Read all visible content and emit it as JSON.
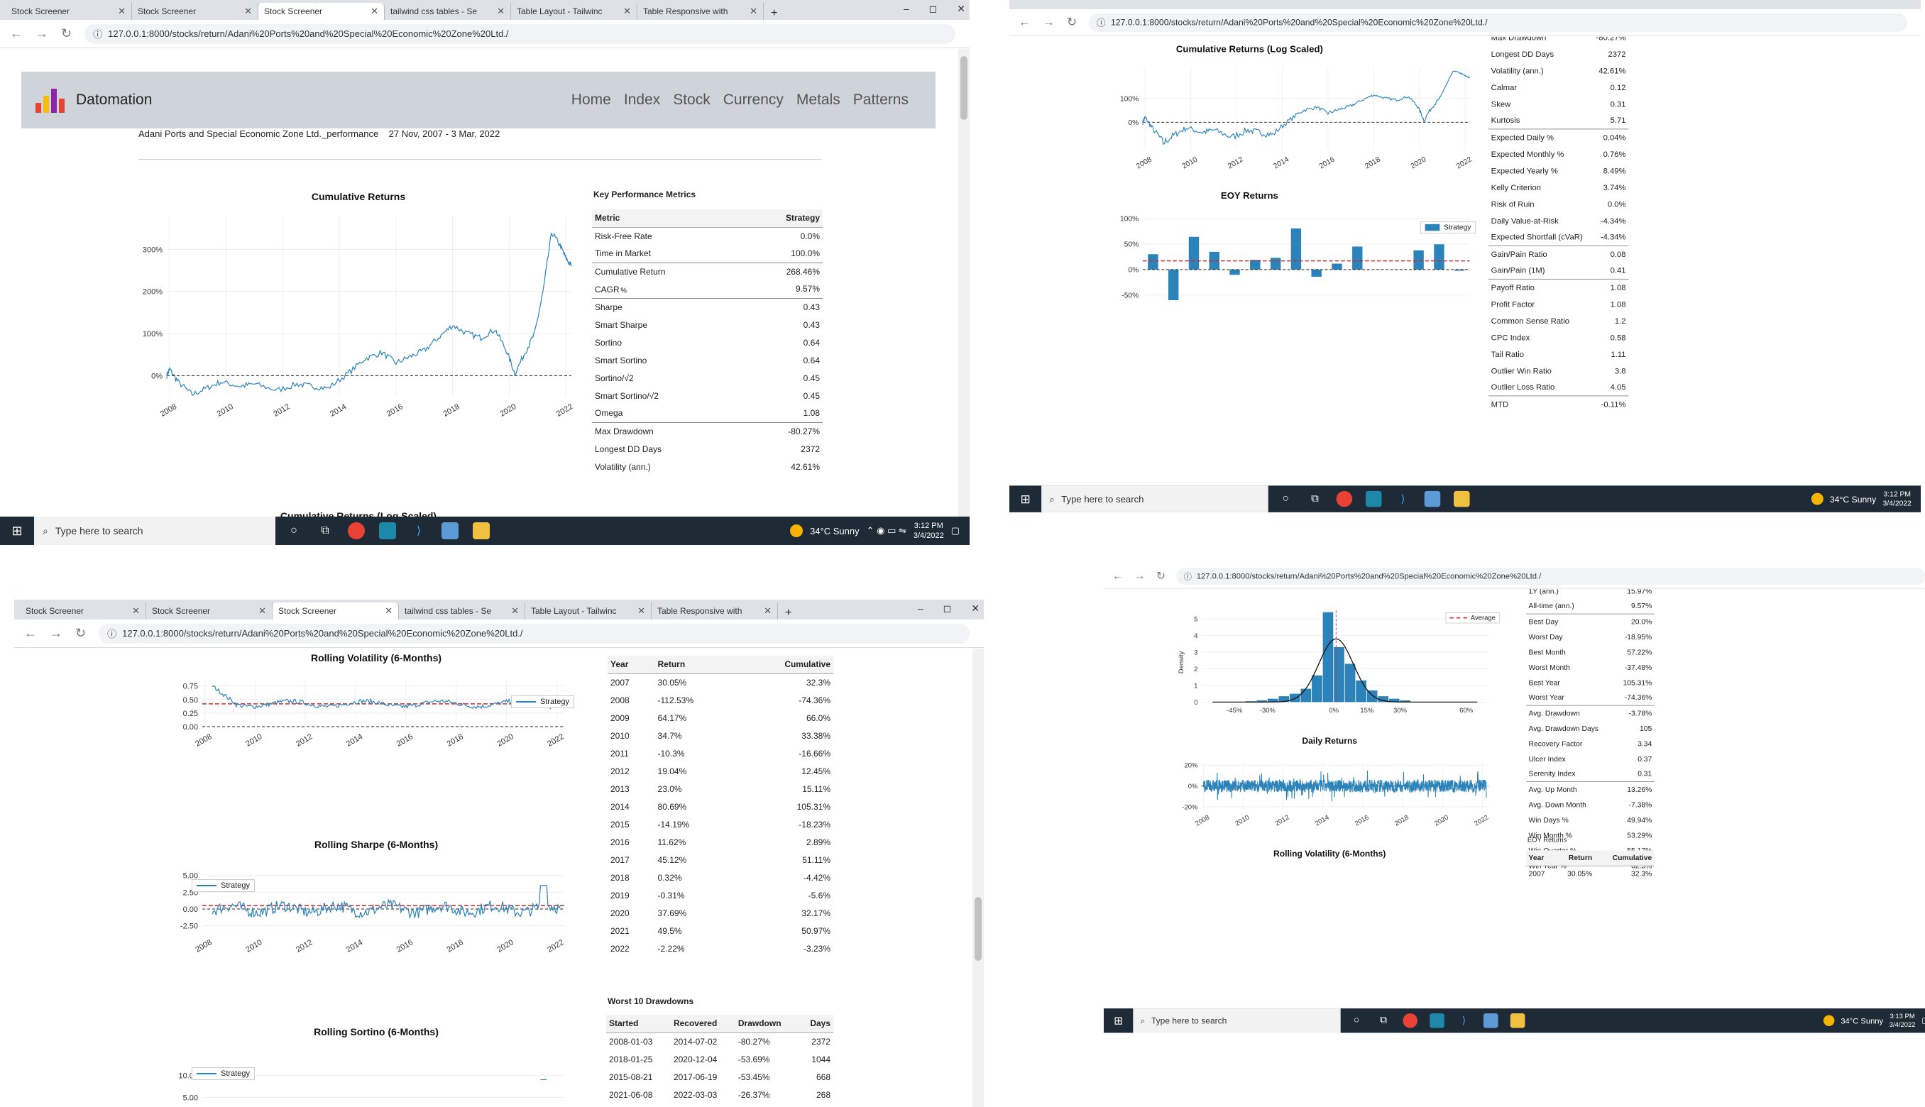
{
  "browser": {
    "tabs": [
      "Stock Screener",
      "Stock Screener",
      "Stock Screener",
      "tailwind css tables - Se",
      "Table Layout - Tailwinc",
      "Table Responsive with"
    ],
    "url": "127.0.0.1:8000/stocks/return/Adani%20Ports%20and%20Special%20Economic%20Zone%20Ltd./",
    "url_q4": "127.0.0.1:8000/stocks/return/Adani%20Ports%20and%20Special%20Economic%20Zone%20Ltd./",
    "new_tab": "+",
    "minimize": "–",
    "maximize": "◻",
    "close": "✕"
  },
  "navbar": {
    "brand": "Datomation",
    "links": [
      "Home",
      "Index",
      "Stock",
      "Currency",
      "Metals",
      "Patterns"
    ]
  },
  "report": {
    "subtitle": "Adani Ports and Special Economic Zone Ltd._performance",
    "date_range": "27 Nov, 2007 - 3 Mar, 2022"
  },
  "charts": {
    "cumulative_title": "Cumulative Returns",
    "cumulative_log_title": "Cumulative Returns (Log Scaled)",
    "eoy_title": "EOY Returns",
    "daily_title": "Daily Returns",
    "rolling_vol_title": "Rolling Volatility (6-Months)",
    "rolling_sharpe_title": "Rolling Sharpe (6-Months)",
    "rolling_sortino_title": "Rolling Sortino (6-Months)",
    "years": [
      "2008",
      "2010",
      "2012",
      "2014",
      "2016",
      "2018",
      "2020",
      "2022"
    ],
    "cum_yticks": [
      "300%",
      "200%",
      "100%",
      "0%"
    ],
    "log_yticks": [
      "100%",
      "0%"
    ],
    "eoy_yticks": [
      "100%",
      "50%",
      "0%",
      "-50%"
    ],
    "daily_yticks": [
      "20%",
      "0%",
      "-20%"
    ],
    "vol_yticks": [
      "0.75",
      "0.50",
      "0.25",
      "0.00"
    ],
    "sharpe_yticks": [
      "5.00",
      "2.50",
      "0.00",
      "-2.50"
    ],
    "sortino_yticks": [
      "10.00",
      "5.00"
    ],
    "hist_yticks": [
      "5",
      "4",
      "3",
      "2",
      "1",
      "0"
    ],
    "hist_xticks": [
      "-45%",
      "-30%",
      "0%",
      "15%",
      "30%",
      "60%"
    ],
    "hist_ylabel": "Density",
    "legend_strategy": "Strategy",
    "legend_average": "Average"
  },
  "chart_data": [
    {
      "type": "line",
      "title": "Cumulative Returns",
      "x_range": [
        2007.9,
        2022.2
      ],
      "ylim": [
        -50,
        380
      ],
      "series": [
        {
          "name": "Strategy",
          "points": [
            [
              2007.9,
              0
            ],
            [
              2008.0,
              15
            ],
            [
              2008.3,
              -15
            ],
            [
              2008.8,
              -45
            ],
            [
              2009.3,
              -30
            ],
            [
              2009.8,
              -15
            ],
            [
              2010.5,
              -25
            ],
            [
              2011.0,
              -20
            ],
            [
              2011.8,
              -35
            ],
            [
              2012.5,
              -20
            ],
            [
              2013.0,
              -25
            ],
            [
              2013.6,
              -30
            ],
            [
              2014.3,
              5
            ],
            [
              2014.9,
              40
            ],
            [
              2015.5,
              55
            ],
            [
              2016.0,
              30
            ],
            [
              2016.5,
              45
            ],
            [
              2017.0,
              60
            ],
            [
              2017.5,
              90
            ],
            [
              2018.0,
              120
            ],
            [
              2018.5,
              100
            ],
            [
              2019.0,
              90
            ],
            [
              2019.5,
              110
            ],
            [
              2019.9,
              60
            ],
            [
              2020.2,
              5
            ],
            [
              2020.6,
              60
            ],
            [
              2020.9,
              100
            ],
            [
              2021.2,
              200
            ],
            [
              2021.5,
              340
            ],
            [
              2021.8,
              310
            ],
            [
              2022.0,
              280
            ],
            [
              2022.2,
              260
            ]
          ]
        }
      ]
    },
    {
      "type": "bar",
      "title": "EOY Returns",
      "categories": [
        "2007",
        "2008",
        "2009",
        "2010",
        "2011",
        "2012",
        "2013",
        "2014",
        "2015",
        "2016",
        "2017",
        "2018",
        "2019",
        "2020",
        "2021",
        "2022"
      ],
      "values": [
        30.05,
        -112.53,
        64.17,
        34.7,
        -10.3,
        19.04,
        23.0,
        80.69,
        -14.19,
        11.62,
        45.12,
        0.32,
        -0.31,
        37.69,
        49.5,
        -2.22
      ],
      "ylim": [
        -60,
        110
      ],
      "series": [
        {
          "name": "Strategy"
        }
      ]
    }
  ],
  "metrics": {
    "title": "Key Performance Metrics",
    "header": [
      "Metric",
      "Strategy"
    ],
    "rows": [
      [
        "Risk-Free Rate",
        "0.0%"
      ],
      [
        "Time in Market",
        "100.0%"
      ],
      [
        "Cumulative Return",
        "268.46%"
      ],
      [
        "CAGR﹪",
        "9.57%"
      ],
      [
        "Sharpe",
        "0.43"
      ],
      [
        "Smart Sharpe",
        "0.43"
      ],
      [
        "Sortino",
        "0.64"
      ],
      [
        "Smart Sortino",
        "0.64"
      ],
      [
        "Sortino/√2",
        "0.45"
      ],
      [
        "Smart Sortino/√2",
        "0.45"
      ],
      [
        "Omega",
        "1.08"
      ],
      [
        "Max Drawdown",
        "-80.27%"
      ],
      [
        "Longest DD Days",
        "2372"
      ],
      [
        "Volatility (ann.)",
        "42.61%"
      ]
    ],
    "q2_rows": [
      [
        "Max Drawdown",
        "-80.27%"
      ],
      [
        "Longest DD Days",
        "2372"
      ],
      [
        "Volatility (ann.)",
        "42.61%"
      ],
      [
        "Calmar",
        "0.12"
      ],
      [
        "Skew",
        "0.31"
      ],
      [
        "Kurtosis",
        "5.71"
      ],
      [
        "Expected Daily %",
        "0.04%"
      ],
      [
        "Expected Monthly %",
        "0.76%"
      ],
      [
        "Expected Yearly %",
        "8.49%"
      ],
      [
        "Kelly Criterion",
        "3.74%"
      ],
      [
        "Risk of Ruin",
        "0.0%"
      ],
      [
        "Daily Value-at-Risk",
        "-4.34%"
      ],
      [
        "Expected Shortfall (cVaR)",
        "-4.34%"
      ],
      [
        "Gain/Pain Ratio",
        "0.08"
      ],
      [
        "Gain/Pain (1M)",
        "0.41"
      ],
      [
        "Payoff Ratio",
        "1.08"
      ],
      [
        "Profit Factor",
        "1.08"
      ],
      [
        "Common Sense Ratio",
        "1.2"
      ],
      [
        "CPC Index",
        "0.58"
      ],
      [
        "Tail Ratio",
        "1.11"
      ],
      [
        "Outlier Win Ratio",
        "3.8"
      ],
      [
        "Outlier Loss Ratio",
        "4.05"
      ],
      [
        "MTD",
        "-0.11%"
      ]
    ],
    "q4_rows": [
      [
        "1Y (ann.)",
        "15.97%"
      ],
      [
        "All-time (ann.)",
        "9.57%"
      ],
      [
        "Best Day",
        "20.0%"
      ],
      [
        "Worst Day",
        "-18.95%"
      ],
      [
        "Best Month",
        "57.22%"
      ],
      [
        "Worst Month",
        "-37.48%"
      ],
      [
        "Best Year",
        "105.31%"
      ],
      [
        "Worst Year",
        "-74.36%"
      ],
      [
        "Avg. Drawdown",
        "-3.78%"
      ],
      [
        "Avg. Drawdown Days",
        "105"
      ],
      [
        "Recovery Factor",
        "3.34"
      ],
      [
        "Ulcer Index",
        "0.37"
      ],
      [
        "Serenity Index",
        "0.31"
      ],
      [
        "Avg. Up Month",
        "13.26%"
      ],
      [
        "Avg. Down Month",
        "-7.38%"
      ],
      [
        "Win Days %",
        "49.94%"
      ],
      [
        "Win Month %",
        "53.29%"
      ],
      [
        "Win Quarter %",
        "55.17%"
      ],
      [
        "Win Year %",
        "62.5%"
      ]
    ]
  },
  "eoy_table": {
    "title": "EOY Returns",
    "header": [
      "Year",
      "Return",
      "Cumulative"
    ],
    "rows": [
      [
        "2007",
        "30.05%",
        "32.3%"
      ],
      [
        "2008",
        "-112.53%",
        "-74.36%"
      ],
      [
        "2009",
        "64.17%",
        "66.0%"
      ],
      [
        "2010",
        "34.7%",
        "33.38%"
      ],
      [
        "2011",
        "-10.3%",
        "-16.66%"
      ],
      [
        "2012",
        "19.04%",
        "12.45%"
      ],
      [
        "2013",
        "23.0%",
        "15.11%"
      ],
      [
        "2014",
        "80.69%",
        "105.31%"
      ],
      [
        "2015",
        "-14.19%",
        "-18.23%"
      ],
      [
        "2016",
        "11.62%",
        "2.89%"
      ],
      [
        "2017",
        "45.12%",
        "51.11%"
      ],
      [
        "2018",
        "0.32%",
        "-4.42%"
      ],
      [
        "2019",
        "-0.31%",
        "-5.6%"
      ],
      [
        "2020",
        "37.69%",
        "32.17%"
      ],
      [
        "2021",
        "49.5%",
        "50.97%"
      ],
      [
        "2022",
        "-2.22%",
        "-3.23%"
      ]
    ],
    "q4_first": [
      "2007",
      "30.05%",
      "32.3%"
    ]
  },
  "drawdowns": {
    "title": "Worst 10 Drawdowns",
    "header": [
      "Started",
      "Recovered",
      "Drawdown",
      "Days"
    ],
    "rows": [
      [
        "2008-01-03",
        "2014-07-02",
        "-80.27%",
        "2372"
      ],
      [
        "2018-01-25",
        "2020-12-04",
        "-53.69%",
        "1044"
      ],
      [
        "2015-08-21",
        "2017-06-19",
        "-53.45%",
        "668"
      ],
      [
        "2021-06-08",
        "2022-03-03",
        "-26.37%",
        "268"
      ]
    ]
  },
  "taskbar": {
    "search_placeholder": "Type here to search",
    "weather": "34°C  Sunny",
    "time_q1": "3:12 PM",
    "time_q4": "3:13 PM",
    "date": "3/4/2022"
  }
}
